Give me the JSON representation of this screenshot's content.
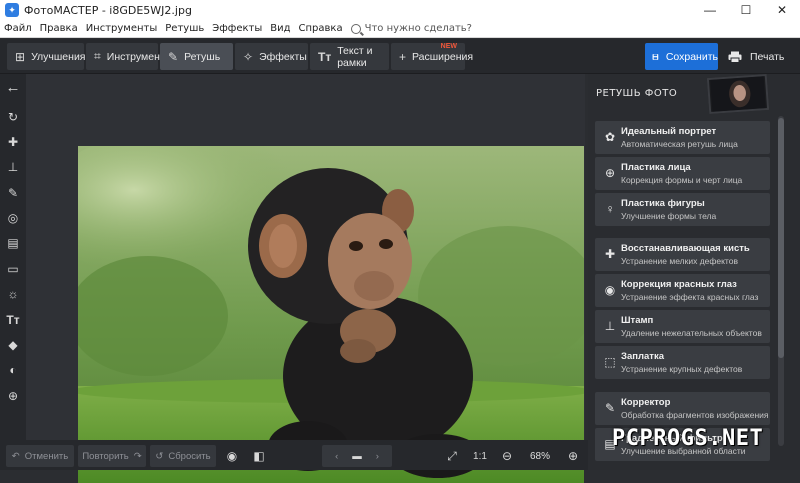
{
  "window": {
    "title": "ФотоМАСТЕР - i8GDE5WJ2.jpg",
    "controls": [
      "—",
      "☐",
      "✕"
    ]
  },
  "menu": {
    "items": [
      "Файл",
      "Правка",
      "Инструменты",
      "Ретушь",
      "Эффекты",
      "Вид",
      "Справка"
    ],
    "search_placeholder": "Что нужно сделать?"
  },
  "toolbar": {
    "tabs": [
      {
        "label": "Улучшения",
        "icon": "enhance-icon"
      },
      {
        "label": "Инструменты",
        "icon": "crop-icon"
      },
      {
        "label": "Ретушь",
        "icon": "brush-icon",
        "active": true
      },
      {
        "label": "Эффекты",
        "icon": "magic-wand-icon"
      },
      {
        "label": "Текст и рамки",
        "icon": "text-icon"
      },
      {
        "label": "Расширения",
        "icon": "plus-icon",
        "badge": "NEW"
      }
    ],
    "save_label": "Сохранить",
    "print_label": "Печать"
  },
  "left_tools": [
    "back-arrow-icon",
    "rotate-icon",
    "bandage-icon",
    "stamp-icon",
    "brush-icon",
    "focus-icon",
    "gradient-icon",
    "vignette-icon",
    "brightness-icon",
    "text-icon",
    "fill-icon",
    "eye-icon",
    "globe-icon"
  ],
  "retouch_panel": {
    "header": "РЕТУШЬ ФОТО",
    "cards": [
      {
        "title": "Идеальный портрет",
        "subtitle": "Автоматическая ретушь лица",
        "icon": "portrait-icon"
      },
      {
        "title": "Пластика лица",
        "subtitle": "Коррекция формы и черт лица",
        "icon": "face-shape-icon"
      },
      {
        "title": "Пластика фигуры",
        "subtitle": "Улучшение формы тела",
        "icon": "figure-icon"
      },
      {
        "title": "Восстанавливающая кисть",
        "subtitle": "Устранение мелких дефектов",
        "icon": "bandage-icon"
      },
      {
        "title": "Коррекция красных глаз",
        "subtitle": "Устранение эффекта красных глаз",
        "icon": "eye-icon"
      },
      {
        "title": "Штамп",
        "subtitle": "Удаление нежелательных объектов",
        "icon": "stamp-icon"
      },
      {
        "title": "Заплатка",
        "subtitle": "Устранение крупных дефектов",
        "icon": "patch-icon"
      },
      {
        "title": "Корректор",
        "subtitle": "Обработка фрагментов изображения",
        "icon": "corrector-brush-icon"
      },
      {
        "title": "Градиентный фильтр",
        "subtitle": "Улучшение выбранной области",
        "icon": "gradient-icon"
      }
    ]
  },
  "bottom": {
    "undo_label": "Отменить",
    "redo_label": "Повторить",
    "reset_label": "Сбросить",
    "ratio_label": "1:1",
    "zoom_value": "68%"
  },
  "watermark": "PCPROGS.NET",
  "colors": {
    "accent": "#1d6fd8",
    "new_badge": "#f0573a"
  }
}
